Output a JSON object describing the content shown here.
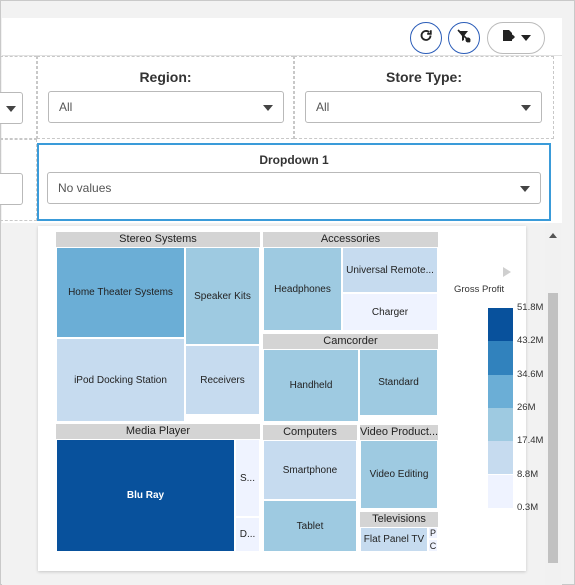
{
  "toolbar": {
    "refresh_icon": "refresh-icon",
    "filter_off_icon": "filter-off-icon",
    "export_icon": "export-icon"
  },
  "filters": {
    "region": {
      "label": "Region:",
      "value": "All"
    },
    "store_type": {
      "label": "Store Type:",
      "value": "All"
    },
    "left_partial": {
      "value": ""
    },
    "dropdown1": {
      "label": "Dropdown 1",
      "value": "No values"
    }
  },
  "treemap": {
    "legend": {
      "title": "Gross Profit",
      "ticks": [
        "51.8M",
        "43.2M",
        "34.6M",
        "26M",
        "17.4M",
        "8.8M",
        "0.3M"
      ],
      "colors": [
        "#08519c",
        "#3182bd",
        "#6baed6",
        "#9ecae1",
        "#c6dbef",
        "#eff3ff"
      ]
    },
    "groups": {
      "stereo": "Stereo Systems",
      "accessories": "Accessories",
      "camcorder": "Camcorder",
      "media": "Media Player",
      "computers": "Computers",
      "video": "Video Product...",
      "televisions": "Televisions"
    },
    "tiles": {
      "home_theater": "Home Theater Systems",
      "speaker_kits": "Speaker Kits",
      "ipod_docking": "iPod Docking Station",
      "receivers": "Receivers",
      "headphones": "Headphones",
      "universal_remote": "Universal Remote...",
      "charger": "Charger",
      "handheld": "Handheld",
      "standard": "Standard",
      "blu_ray": "Blu Ray",
      "media_s": "S...",
      "media_d": "D...",
      "smartphone": "Smartphone",
      "tablet": "Tablet",
      "video_editing": "Video Editing",
      "flat_panel": "Flat Panel TV",
      "tv_p": "P",
      "tv_c": "C"
    }
  }
}
